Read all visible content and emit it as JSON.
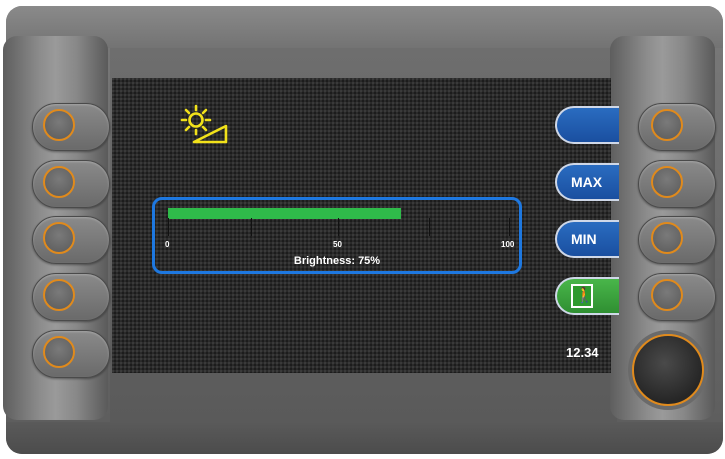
{
  "screen": {
    "softkeys": [
      {
        "label": ""
      },
      {
        "label": "MAX"
      },
      {
        "label": "MIN"
      },
      {
        "label": "",
        "icon": "exit-icon"
      }
    ],
    "readout": "12.34",
    "meter": {
      "tick_labels": [
        "0",
        "50",
        "100"
      ],
      "caption": "Brightness: 75%",
      "value_percent": 75,
      "fill_color": "#2fbb4a",
      "border_color": "#1e78e0"
    },
    "icons": {
      "brightness": "sun-incline-icon",
      "exit": "emergency-exit-icon"
    }
  },
  "colors": {
    "accent_orange": "#e08a1c",
    "softkey_blue": "#1a4fa0",
    "exit_green": "#2f8f32"
  }
}
